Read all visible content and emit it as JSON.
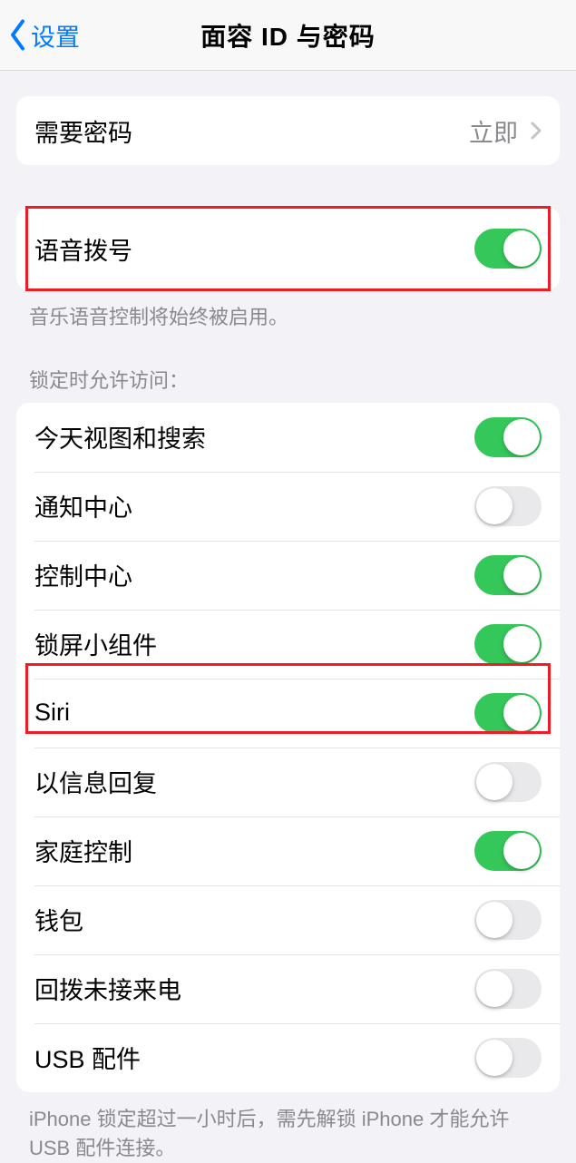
{
  "nav": {
    "back_label": "设置",
    "title": "面容 ID 与密码"
  },
  "require_passcode": {
    "label": "需要密码",
    "value": "立即"
  },
  "voice_dial": {
    "label": "语音拨号",
    "on": true,
    "footer": "音乐语音控制将始终被启用。"
  },
  "locked_access": {
    "header": "锁定时允许访问：",
    "items": [
      {
        "label": "今天视图和搜索",
        "on": true
      },
      {
        "label": "通知中心",
        "on": false
      },
      {
        "label": "控制中心",
        "on": true
      },
      {
        "label": "锁屏小组件",
        "on": true
      },
      {
        "label": "Siri",
        "on": true
      },
      {
        "label": "以信息回复",
        "on": false
      },
      {
        "label": "家庭控制",
        "on": true
      },
      {
        "label": "钱包",
        "on": false
      },
      {
        "label": "回拨未接来电",
        "on": false
      },
      {
        "label": "USB 配件",
        "on": false
      }
    ],
    "footer": "iPhone 锁定超过一小时后，需先解锁 iPhone 才能允许USB 配件连接。"
  }
}
